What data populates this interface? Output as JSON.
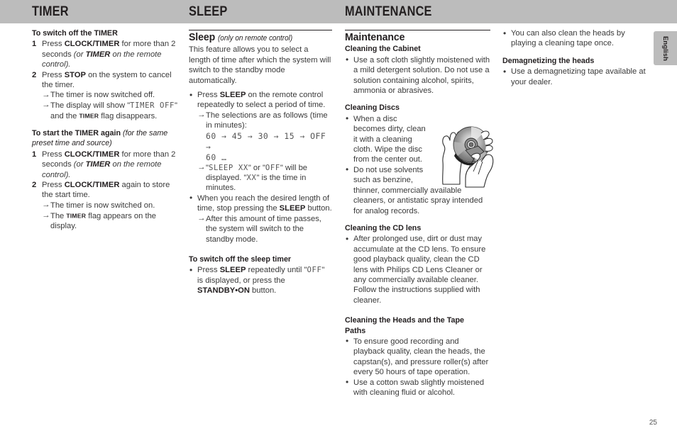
{
  "page": {
    "number": "25",
    "language_tab": "English"
  },
  "header": {
    "titles": [
      {
        "label": "TIMER"
      },
      {
        "label": "SLEEP"
      },
      {
        "label": "MAINTENANCE"
      }
    ]
  },
  "timer": {
    "switch_off": {
      "heading": "To switch off the TIMER",
      "step1_num": "1",
      "step1_a": "Press ",
      "step1_b": "CLOCK/TIMER",
      "step1_c": " for more than 2 seconds ",
      "step1_d": "(or ",
      "step1_e": "TIMER",
      "step1_f": " on the remote control).",
      "step2_num": "2",
      "step2_a": "Press ",
      "step2_b": "STOP",
      "step2_c": " on the system to cancel the timer.",
      "arrow1": "The timer is now switched off.",
      "arrow2_a": "The display will show \"",
      "arrow2_lcd": "TIMER OFF",
      "arrow2_b": "\" and the ",
      "arrow2_flag": "TIMER",
      "arrow2_c": " flag disappears."
    },
    "start_again": {
      "heading": "To start the TIMER again",
      "heading_sub": "(for the same preset time and source)",
      "step1_num": "1",
      "step1_a": "Press ",
      "step1_b": "CLOCK/TIMER",
      "step1_c": " for more than 2 seconds ",
      "step1_d": "(or ",
      "step1_e": "TIMER",
      "step1_f": " on the remote control).",
      "step2_num": "2",
      "step2_a": "Press ",
      "step2_b": "CLOCK/TIMER",
      "step2_c": " again to store the start time.",
      "arrow1": "The timer is now switched on.",
      "arrow2_a": "The ",
      "arrow2_flag": "TIMER",
      "arrow2_b": " flag appears on the display."
    }
  },
  "sleep": {
    "title": "Sleep",
    "title_sub": "(only on remote control)",
    "intro": "This feature allows you to select a length of time after which the system will switch to the standby mode automatically.",
    "bullet1_a": "Press ",
    "bullet1_b": "SLEEP",
    "bullet1_c": " on the remote control repeatedly to select a period of time.",
    "arrow1": "The selections are as follows (time in minutes):",
    "sequence_line1": "60 → 45 → 30 →  15 → OFF →",
    "sequence_line2": "60 …",
    "arrow2_a": "\"",
    "arrow2_lcd1": "SLEEP  XX",
    "arrow2_b": "\" or \"",
    "arrow2_lcd2": "OFF",
    "arrow2_c": "\" will be displayed. \"",
    "arrow2_lcd3": "XX",
    "arrow2_d": "\" is the time in minutes.",
    "bullet2_a": "When you reach the desired length of time, stop pressing the ",
    "bullet2_b": "SLEEP",
    "bullet2_c": " button.",
    "arrow3": "After this amount of time passes, the system will switch to the standby mode.",
    "switch_off_heading": "To switch off the sleep timer",
    "switch_off_a": "Press ",
    "switch_off_b": "SLEEP",
    "switch_off_c": " repeatedly until \"",
    "switch_off_lcd": "OFF",
    "switch_off_d": "\" is displayed, or press the ",
    "switch_off_e": "STANDBY•ON",
    "switch_off_f": " button."
  },
  "maintenance": {
    "title": "Maintenance",
    "cabinet": {
      "heading": "Cleaning the Cabinet",
      "bullet1": "Use a soft cloth slightly moistened with a mild detergent solution. Do not use a solution containing alcohol, spirits, ammonia or abrasives."
    },
    "discs": {
      "heading": "Cleaning Discs",
      "bullet1": "When a disc becomes dirty, clean it with a cleaning cloth. Wipe the disc from the center out.",
      "bullet2_part1": "Do not use solvents such as benzine,",
      "bullet2_part2": "thinner, commercially available cleaners, or antistatic spray intended for analog records.",
      "illustration": "hands-cleaning-disc-illustration"
    },
    "cd_lens": {
      "heading": "Cleaning the CD lens",
      "bullet1": "After prolonged use, dirt or dust may accumulate at the CD lens. To ensure good playback quality, clean the CD lens with Philips CD Lens Cleaner or any commercially available cleaner. Follow the instructions supplied with cleaner."
    },
    "heads": {
      "heading": "Cleaning the Heads and the Tape Paths",
      "bullet1": "To ensure good recording and playback quality, clean the heads, the capstan(s), and pressure roller(s) after every 50 hours of tape operation.",
      "bullet2": "Use a cotton swab slightly moistened with cleaning fluid or alcohol.",
      "bullet3": "You can also clean the heads by playing a cleaning tape once."
    },
    "demagnetizing": {
      "heading": "Demagnetizing the heads",
      "bullet1": "Use a demagnetizing tape available at your dealer."
    }
  },
  "markers": {
    "bullet": "•",
    "arrow": "→"
  },
  "colors": {
    "header_bar": "#bcbcbc",
    "text": "#3a3a3a",
    "heading": "#231f20",
    "lcd_text": "#555555"
  }
}
